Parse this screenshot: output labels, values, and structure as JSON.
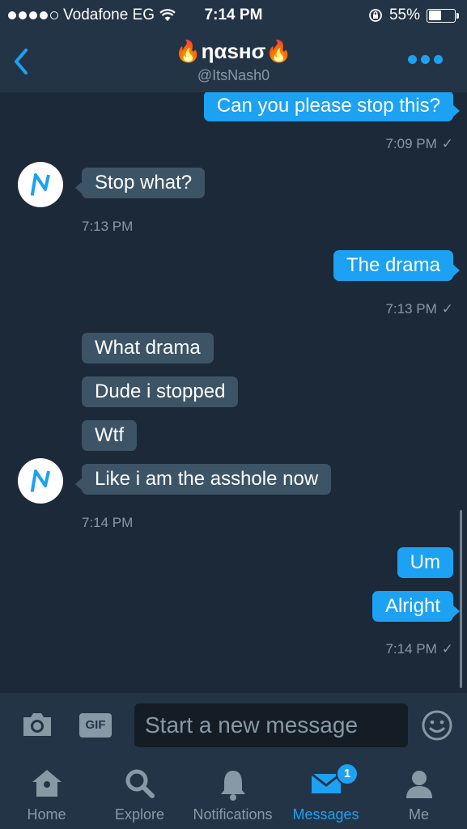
{
  "status_bar": {
    "carrier": "Vodafone EG",
    "time": "7:14 PM",
    "battery": "55%",
    "battery_level": 0.55
  },
  "header": {
    "title": "🔥ηαѕнσ🔥",
    "handle": "@ItsNash0"
  },
  "messages": [
    {
      "text": "Can you please stop this?",
      "side": "out"
    },
    {
      "text": "7:09 PM",
      "kind": "timestamp"
    },
    {
      "text": "Stop what?",
      "side": "in"
    },
    {
      "text": "7:13 PM",
      "kind": "timestamp"
    },
    {
      "text": "The drama",
      "side": "out"
    },
    {
      "text": "7:13 PM",
      "kind": "timestamp"
    },
    {
      "text": "What drama",
      "side": "in"
    },
    {
      "text": "Dude i stopped",
      "side": "in"
    },
    {
      "text": "Wtf",
      "side": "in"
    },
    {
      "text": "Like i am the asshole now",
      "side": "in"
    },
    {
      "text": "7:14 PM",
      "kind": "timestamp"
    },
    {
      "text": "Um",
      "side": "out"
    },
    {
      "text": "Alright",
      "side": "out"
    },
    {
      "text": "7:14 PM",
      "kind": "timestamp"
    }
  ],
  "read_check": "✓",
  "composer": {
    "placeholder": "Start a new message",
    "gif_label": "GIF"
  },
  "tabs": [
    {
      "label": "Home",
      "icon": "home-icon"
    },
    {
      "label": "Explore",
      "icon": "search-icon"
    },
    {
      "label": "Notifications",
      "icon": "bell-icon"
    },
    {
      "label": "Messages",
      "icon": "envelope-icon",
      "active": true,
      "badge": "1"
    },
    {
      "label": "Me",
      "icon": "person-icon"
    }
  ],
  "colors": {
    "accent": "#1da1f2",
    "background": "#1c2938",
    "bar": "#243447",
    "incoming_bubble": "#3d5466",
    "muted": "#8899a6"
  }
}
